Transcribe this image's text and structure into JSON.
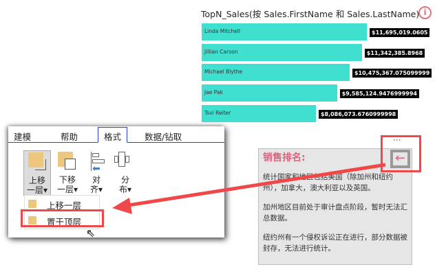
{
  "chart": {
    "title": "TopN_Sales(按 Sales.FirstName 和 Sales.LastName)",
    "info_icon": "info-icon",
    "bars": [
      {
        "name": "Linda Mitchell",
        "value": 11695019.0605,
        "label": "$11,695,019.0605"
      },
      {
        "name": "Jillian Carson",
        "value": 11342385.8968,
        "label": "$11,342,385.8968"
      },
      {
        "name": "Michael Blythe",
        "value": 10475367.0751,
        "label": "$10,475,367.075099999"
      },
      {
        "name": "Jae Pak",
        "value": 9585124.9477,
        "label": "$9,585,124.9476999994"
      },
      {
        "name": "Tsvi Reiter",
        "value": 8086073.6761,
        "label": "$8,086,073.6760999998"
      }
    ],
    "bar_color": "#40e0d0"
  },
  "ribbon": {
    "tabs": [
      "建模",
      "帮助",
      "格式",
      "数据/钻取"
    ],
    "active_tab": "格式",
    "buttons": [
      {
        "l1": "上移",
        "l2": "一层▾"
      },
      {
        "l1": "下移",
        "l2": "一层▾"
      },
      {
        "l1": "对",
        "l2": "齐▾"
      },
      {
        "l1": "分",
        "l2": "布▾"
      }
    ],
    "menu": [
      "上移一层",
      "置于顶层"
    ]
  },
  "textbox": {
    "title": "销售排名:",
    "paragraphs": [
      "统计国家和地区包括美国（除加州和纽约州），加拿大，澳大利亚以及英国。",
      "加州地区目前处于审计盘点阶段，暂时无法汇总数据。",
      "纽约州有一个侵权诉讼正在进行，部分数据被封存，无法进行统计。"
    ],
    "more": "···"
  },
  "accent": "#f04848"
}
